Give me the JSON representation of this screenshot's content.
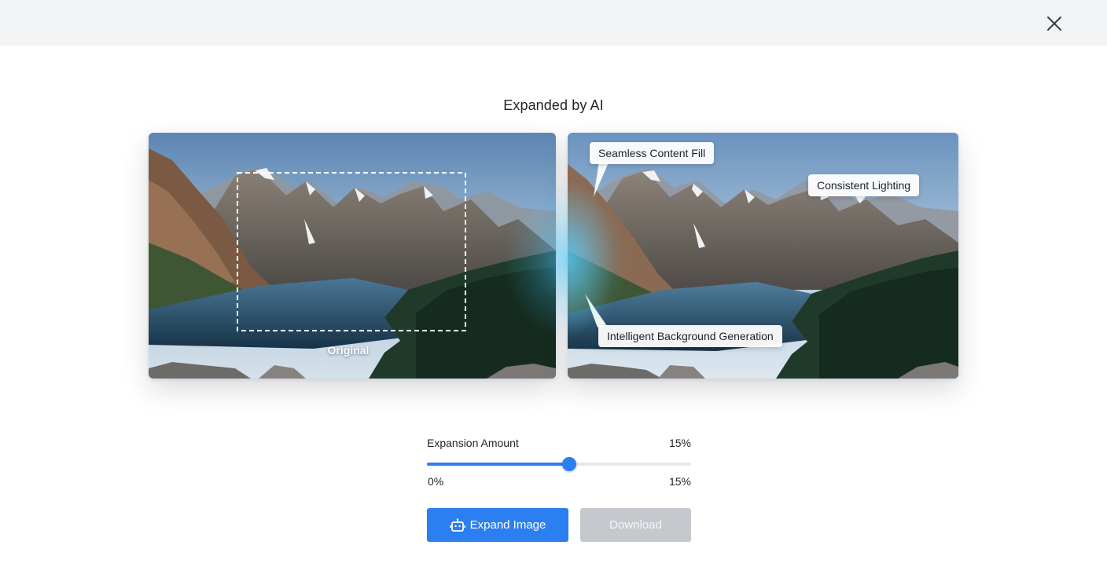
{
  "header": {
    "close_icon": "close-icon"
  },
  "title": "Expanded by AI",
  "comparison": {
    "original_label": "Original",
    "callouts": {
      "seamless": "Seamless Content Fill",
      "lighting": "Consistent Lighting",
      "background": "Intelligent Background Generation"
    }
  },
  "slider": {
    "label": "Expansion Amount",
    "value_text": "15%",
    "min_label": "0%",
    "max_label": "15%",
    "fill_fraction": 0.54
  },
  "buttons": {
    "expand_label": "Expand Image",
    "expand_icon": "robot-icon",
    "download_label": "Download"
  },
  "colors": {
    "accent": "#2b7ff0",
    "disabled": "#c5c8cd",
    "header_bg": "#f2f3f5"
  }
}
